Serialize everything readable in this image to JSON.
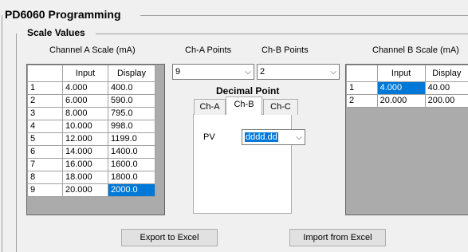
{
  "outer_group": {
    "title": "PD6060 Programming"
  },
  "scale_group": {
    "title": "Scale Values"
  },
  "channel_a": {
    "caption": "Channel A Scale (mA)",
    "col_input": "Input",
    "col_display": "Display",
    "rows": [
      {
        "n": "1",
        "input": "4.000",
        "display": "400.0"
      },
      {
        "n": "2",
        "input": "6.000",
        "display": "590.0"
      },
      {
        "n": "3",
        "input": "8.000",
        "display": "795.0"
      },
      {
        "n": "4",
        "input": "10.000",
        "display": "998.0"
      },
      {
        "n": "5",
        "input": "12.000",
        "display": "1199.0"
      },
      {
        "n": "6",
        "input": "14.000",
        "display": "1400.0"
      },
      {
        "n": "7",
        "input": "16.000",
        "display": "1600.0"
      },
      {
        "n": "8",
        "input": "18.000",
        "display": "1800.0"
      },
      {
        "n": "9",
        "input": "20.000",
        "display": "2000.0"
      }
    ]
  },
  "ch_a_points": {
    "label": "Ch-A Points",
    "value": "9"
  },
  "ch_b_points": {
    "label": "Ch-B Points",
    "value": "2"
  },
  "decimal_point": {
    "label": "Decimal Point",
    "tabs": [
      "Ch-A",
      "Ch-B",
      "Ch-C"
    ],
    "active_tab": "Ch-B",
    "pv_label": "PV",
    "pv_value": "dddd.dd"
  },
  "channel_b": {
    "caption": "Channel B Scale (mA)",
    "col_input": "Input",
    "col_display": "Display",
    "rows": [
      {
        "n": "1",
        "input": "4.000",
        "display": "40.00"
      },
      {
        "n": "2",
        "input": "20.000",
        "display": "200.00"
      }
    ]
  },
  "buttons": {
    "export": "Export to Excel",
    "import": "Import from Excel"
  },
  "icons": {
    "dropdown": "chevron-down-icon"
  },
  "colors": {
    "selection": "#0078d7",
    "grid_empty": "#ababab"
  }
}
